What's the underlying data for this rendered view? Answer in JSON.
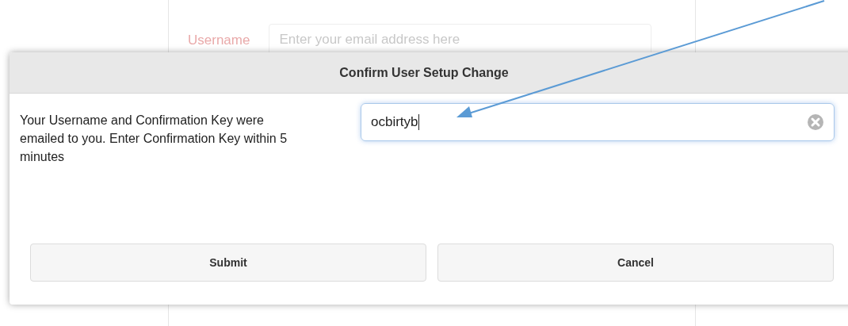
{
  "background_form": {
    "label": "Username",
    "placeholder": "Enter your email address here"
  },
  "dialog": {
    "title": "Confirm User Setup Change",
    "message": "Your Username and Confirmation Key were emailed to you. Enter Confirmation Key within 5 minutes",
    "field": {
      "value": "ocbirtyb"
    },
    "buttons": [
      {
        "label": "Submit"
      },
      {
        "label": "Cancel"
      }
    ]
  }
}
